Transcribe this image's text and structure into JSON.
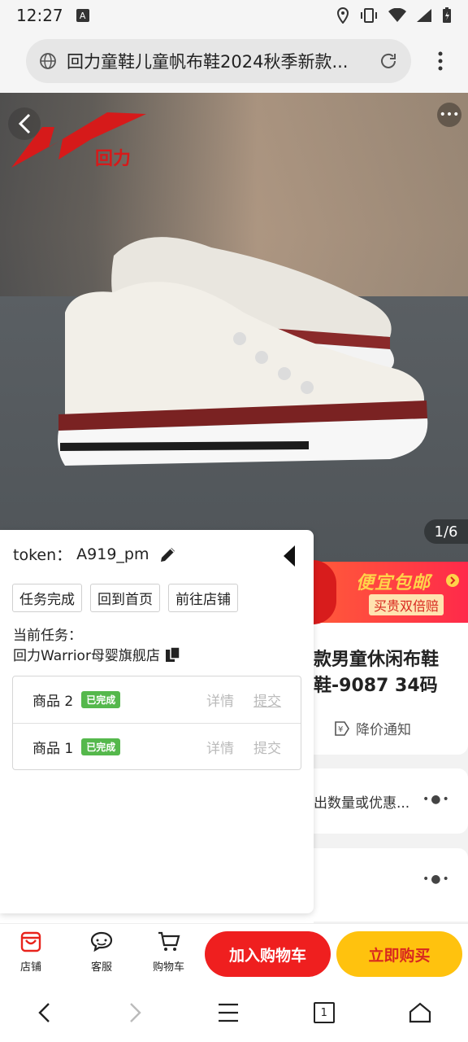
{
  "status": {
    "time": "12:27"
  },
  "url_bar": {
    "title": "回力童鞋儿童帆布鞋2024秋季新款..."
  },
  "hero": {
    "page_indicator": "1/6"
  },
  "promo": {
    "title": "便宜包邮",
    "subtitle": "买贵双倍赔"
  },
  "product": {
    "title_line1": "款男童休闲布鞋",
    "title_line2": "鞋-9087 34码",
    "price_notify": "降价通知",
    "options_text": "出数量或优惠..."
  },
  "panel": {
    "token_label": "token：",
    "token_value": "A919_pm",
    "buttons": [
      "任务完成",
      "回到首页",
      "前往店铺"
    ],
    "task_label": "当前任务：",
    "task_shop": "回力Warrior母婴旗舰店",
    "items": [
      {
        "name": "商品 2",
        "status": "已完成",
        "detail": "详情",
        "submit": "提交"
      },
      {
        "name": "商品 1",
        "status": "已完成",
        "detail": "详情",
        "submit": "提交"
      }
    ]
  },
  "bottom_bar": {
    "tabs": [
      "店铺",
      "客服",
      "购物车"
    ],
    "add_to_cart": "加入购物车",
    "buy_now": "立即购买"
  },
  "nav": {
    "tab_count": "1"
  },
  "colors": {
    "accent_red": "#ef1f1f",
    "accent_yellow": "#ffc20e",
    "badge_green": "#55b84c"
  }
}
